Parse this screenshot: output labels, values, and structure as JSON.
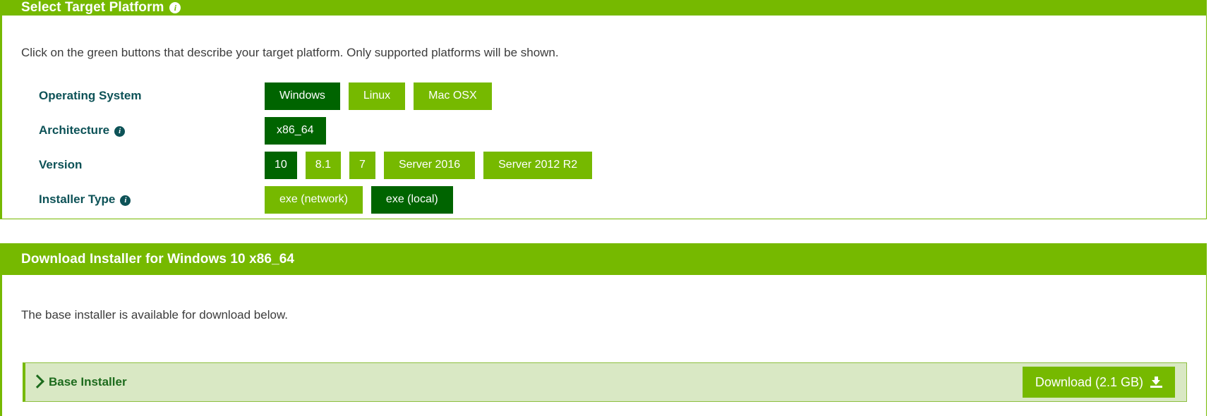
{
  "select_panel": {
    "header_title": "Select Target Platform",
    "header_info_icon": "info-icon",
    "intro_text": "Click on the green buttons that describe your target platform. Only supported platforms will be shown.",
    "rows": [
      {
        "label": "Operating System",
        "has_info_icon": false,
        "buttons": [
          {
            "label": "Windows",
            "selected": true
          },
          {
            "label": "Linux",
            "selected": false
          },
          {
            "label": "Mac OSX",
            "selected": false
          }
        ]
      },
      {
        "label": "Architecture",
        "has_info_icon": true,
        "buttons": [
          {
            "label": "x86_64",
            "selected": true
          }
        ]
      },
      {
        "label": "Version",
        "has_info_icon": false,
        "buttons": [
          {
            "label": "10",
            "selected": true
          },
          {
            "label": "8.1",
            "selected": false
          },
          {
            "label": "7",
            "selected": false
          },
          {
            "label": "Server 2016",
            "selected": false
          },
          {
            "label": "Server 2012 R2",
            "selected": false
          }
        ]
      },
      {
        "label": "Installer Type",
        "has_info_icon": true,
        "buttons": [
          {
            "label": "exe (network)",
            "selected": false
          },
          {
            "label": "exe (local)",
            "selected": true
          }
        ]
      }
    ]
  },
  "download_panel": {
    "header_title": "Download Installer for Windows 10 x86_64",
    "note_text": "The base installer is available for download below.",
    "installer": {
      "chevron_icon": "chevron-right-icon",
      "title": "Base Installer",
      "download_button_label": "Download (2.1 GB)",
      "download_icon": "download-icon"
    }
  },
  "colors": {
    "brand_green": "#76b900",
    "selected_green": "#006400",
    "label_teal": "#0d5257",
    "installer_row_bg": "#d9e8c4",
    "installer_title": "#1d6b1d",
    "body_text": "#3c3c3c"
  }
}
